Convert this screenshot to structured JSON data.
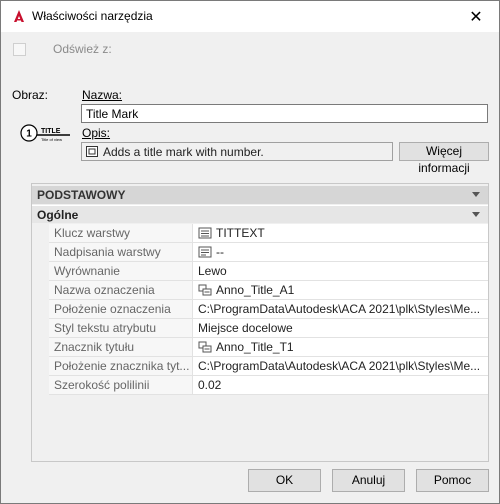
{
  "window": {
    "title": "Właściwości narzędzia",
    "close_glyph": "✕",
    "accent": "#c8102e"
  },
  "refresh": {
    "label": "Odśwież z:",
    "checked": false
  },
  "image_label": "Obraz:",
  "preview": {
    "number": "1",
    "title": "TITLE",
    "sub": "Title of view"
  },
  "name": {
    "label": "Nazwa:",
    "value": "Title Mark"
  },
  "description": {
    "label": "Opis:",
    "value": "Adds a title mark with number.",
    "more_button": "Więcej informacji"
  },
  "properties": {
    "category": "PODSTAWOWY",
    "group": "Ogólne",
    "rows": [
      {
        "key": "Klucz warstwy",
        "value": "TITTEXT",
        "icon": "layer-key-icon"
      },
      {
        "key": "Nadpisania warstwy",
        "value": "--",
        "icon": "layer-override-icon"
      },
      {
        "key": "Wyrównanie",
        "value": "Lewo",
        "icon": ""
      },
      {
        "key": "Nazwa oznaczenia",
        "value": "Anno_Title_A1",
        "icon": "block-icon"
      },
      {
        "key": "Położenie oznaczenia",
        "value": "C:\\ProgramData\\Autodesk\\ACA  2021\\plk\\Styles\\Me...",
        "icon": ""
      },
      {
        "key": "Styl tekstu atrybutu",
        "value": "Miejsce docelowe",
        "icon": ""
      },
      {
        "key": "Znacznik tytułu",
        "value": "Anno_Title_T1",
        "icon": "block-icon"
      },
      {
        "key": "Położenie znacznika tyt...",
        "value": "C:\\ProgramData\\Autodesk\\ACA  2021\\plk\\Styles\\Me...",
        "icon": ""
      },
      {
        "key": "Szerokość polilinii",
        "value": "0.02",
        "icon": ""
      }
    ]
  },
  "buttons": {
    "ok": "OK",
    "cancel": "Anuluj",
    "help": "Pomoc"
  }
}
